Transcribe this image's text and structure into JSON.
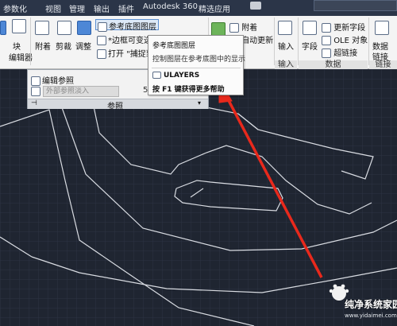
{
  "menubar": {
    "items": [
      "参数化",
      "视图",
      "管理",
      "输出",
      "插件",
      "Autodesk 360",
      "精选应用"
    ]
  },
  "ribbon": {
    "left_partial_label": "块",
    "left_partial_sub": "编辑器",
    "attach_label": "附着",
    "clip_label": "剪裁",
    "adjust_label": "调整",
    "ref_underlay_layers": "参考底图图层",
    "frame_variable": "*边框可变选项*",
    "open_label": "打开",
    "snap_label": "\"捕捉到",
    "attach2_label": "附着",
    "autoupdate_label": "自动更新",
    "insert_label": "输入",
    "field_label": "字段",
    "update_field": "更新字段",
    "ole_object": "OLE 对象",
    "hyperlink": "超链接",
    "data_label": "数据",
    "link_label": "链接",
    "panel_input": "输入",
    "panel_data": "数据",
    "panel_link": "链接"
  },
  "ref_panel": {
    "edit_ref": "编辑参照",
    "input_placeholder": "外部参照淡入",
    "input_value_right": "5",
    "footer_label": "参照"
  },
  "tooltip": {
    "title": "参考底图图层",
    "description": "控制图层在参考底图中的显示",
    "command": "ULAYERS",
    "help": "按 F1 键获得更多帮助"
  },
  "watermark": {
    "title": "纯净系统家园",
    "url": "www.yidaimei.com"
  },
  "colors": {
    "canvas_bg": "#1f2531",
    "menubar_bg": "#2b3548",
    "arrow": "#e8291c"
  }
}
